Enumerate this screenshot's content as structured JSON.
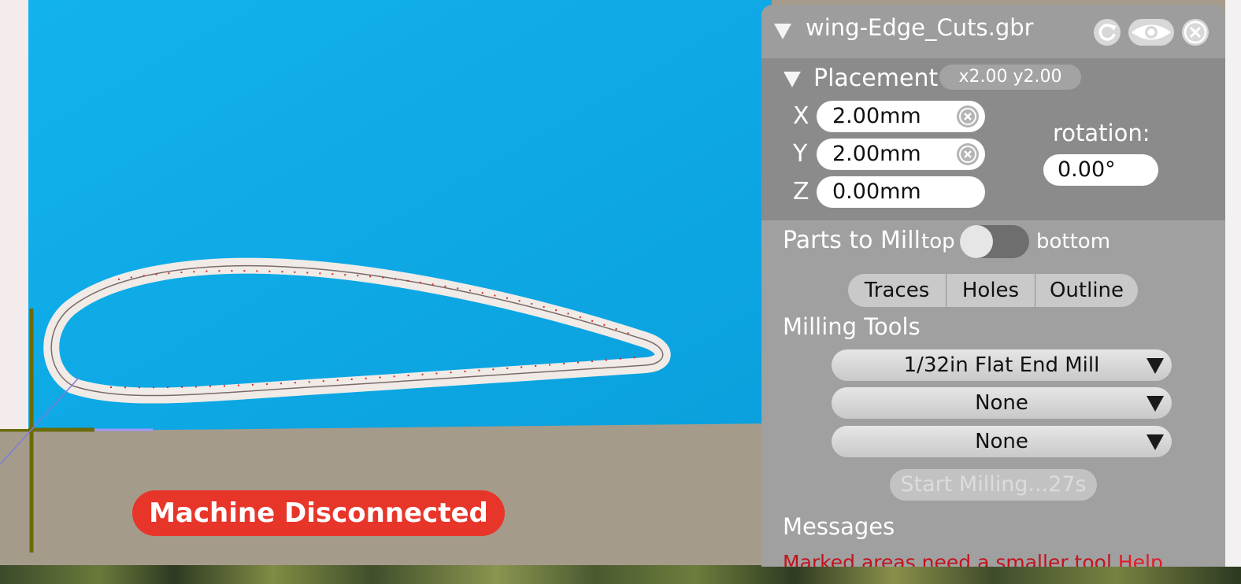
{
  "viewport": {
    "background_color": "#0eaae8",
    "table_color": "#a59b8b",
    "outline_color": "#f0ebe6",
    "axis_color": "#6b6b05"
  },
  "status": {
    "label": "Machine Disconnected",
    "color": "#e8352a"
  },
  "panel": {
    "title": "wing-Edge_Cuts.gbr",
    "icons": [
      "refresh-icon",
      "eye-icon",
      "close-icon"
    ],
    "placement": {
      "label": "Placement",
      "badge": "x2.00 y2.00",
      "x_label": "X",
      "x_value": "2.00mm",
      "y_label": "Y",
      "y_value": "2.00mm",
      "z_label": "Z",
      "z_value": "0.00mm",
      "rotation_label": "rotation:",
      "rotation_value": "0.00°"
    },
    "parts": {
      "label": "Parts to Mill",
      "top": "top",
      "bottom": "bottom"
    },
    "segments": [
      "Traces",
      "Holes",
      "Outline"
    ],
    "milling_tools": {
      "label": "Milling Tools",
      "tools": [
        "1/32in Flat End Mill",
        "None",
        "None"
      ]
    },
    "start_button": "Start Milling...27s",
    "messages": {
      "label": "Messages",
      "text": "Marked areas need a smaller tool",
      "help": "Help"
    }
  }
}
